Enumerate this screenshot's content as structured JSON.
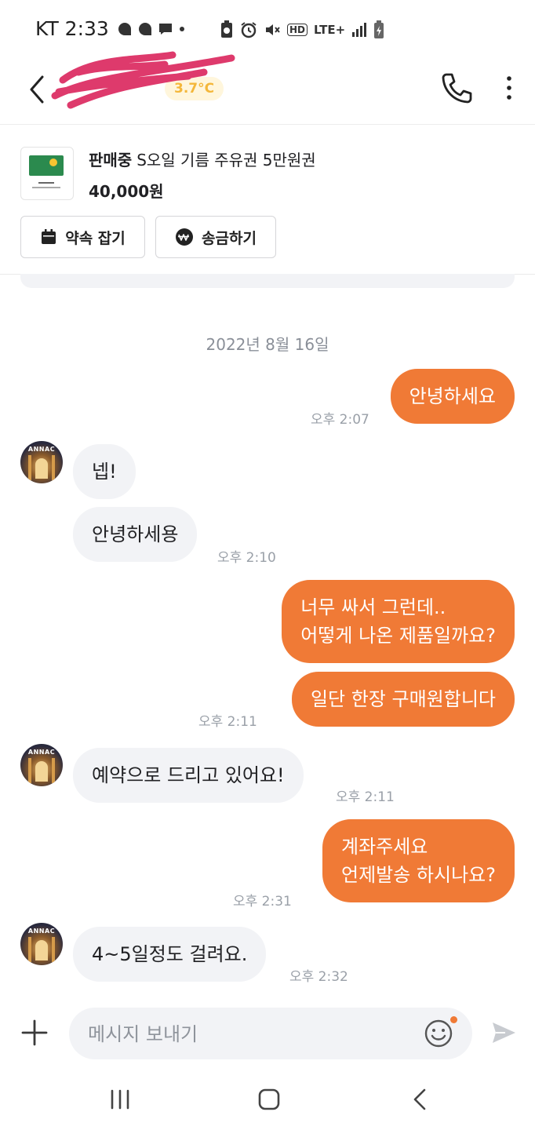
{
  "status_bar": {
    "carrier_time": "KT 2:33",
    "lte": "LTE+",
    "hd": "HD"
  },
  "header": {
    "nickname": "",
    "manner_temp": "3.7°C",
    "icons": [
      "back-arrow-icon",
      "phone-icon",
      "more-vert-icon"
    ]
  },
  "product": {
    "status": "판매중",
    "title": "S오일 기름 주유권 5만원권",
    "price": "40,000원",
    "appointment_label": "약속 잡기",
    "remit_label": "송금하기"
  },
  "chat": {
    "date": "2022년 8월 16일",
    "avatar_text": "ANNAC",
    "messages": [
      {
        "from": "me",
        "lines": [
          "안녕하세요"
        ],
        "time": "오후 2:07"
      },
      {
        "from": "them",
        "lines": [
          "넵!"
        ],
        "time": ""
      },
      {
        "from": "them",
        "lines": [
          "안녕하세용"
        ],
        "time": "오후 2:10"
      },
      {
        "from": "me",
        "lines": [
          "너무 싸서 그런데..",
          "어떻게 나온 제품일까요?"
        ],
        "time": ""
      },
      {
        "from": "me",
        "lines": [
          "일단 한장 구매원합니다"
        ],
        "time": "오후 2:11"
      },
      {
        "from": "them",
        "lines": [
          "예약으로 드리고 있어요!"
        ],
        "time": "오후 2:11"
      },
      {
        "from": "me",
        "lines": [
          "계좌주세요",
          "언제발송 하시나요?"
        ],
        "time": "오후 2:31"
      },
      {
        "from": "them",
        "lines": [
          "4~5일정도 걸려요."
        ],
        "time": "오후 2:32"
      }
    ]
  },
  "input": {
    "placeholder": "메시지 보내기",
    "value": ""
  },
  "colors": {
    "accent": "#f07a36",
    "bubble_theirs": "#f2f3f6",
    "temp": "#f4b73a"
  }
}
